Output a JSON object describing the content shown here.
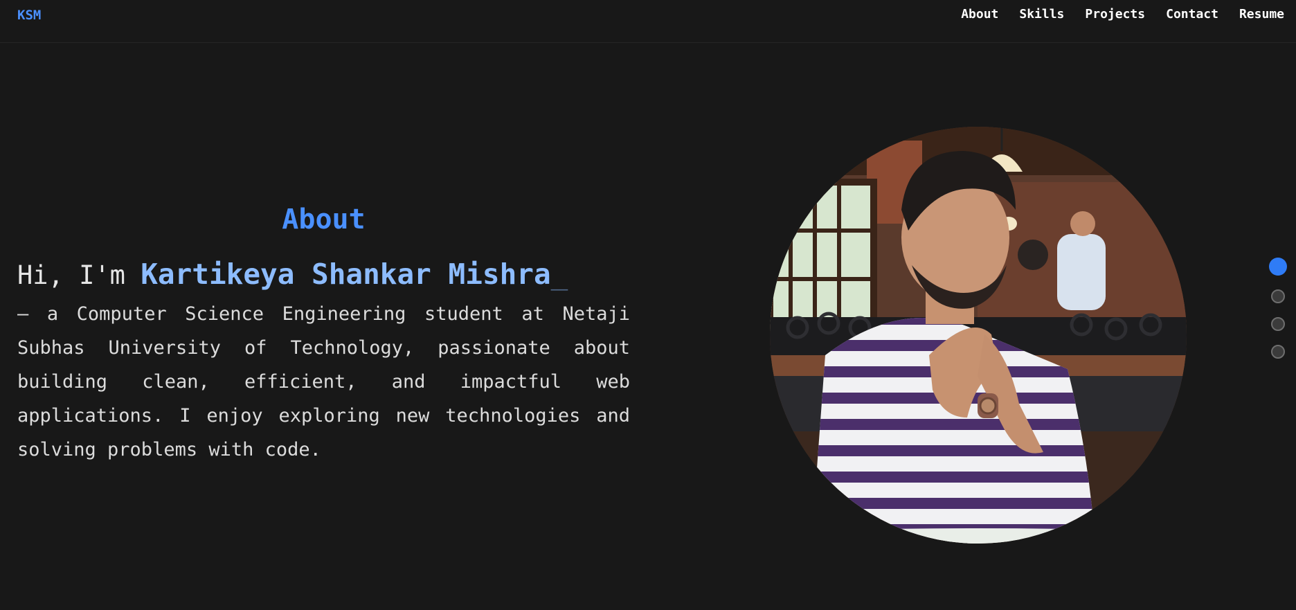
{
  "nav": {
    "logo": "KSM",
    "links": [
      "About",
      "Skills",
      "Projects",
      "Contact",
      "Resume"
    ]
  },
  "about": {
    "title": "About",
    "greeting": "Hi, I'm ",
    "name": "Kartikeya Shankar Mishra",
    "cursor": "_",
    "bio": "— a Computer Science Engineering student at Netaji Subhas University of Technology, passionate about building clean, efficient, and impactful web applications. I enjoy exploring new technologies and solving problems with code.",
    "photo_alt": "Photo of Kartikeya Shankar Mishra"
  },
  "section_nav": {
    "count": 4,
    "active_index": 0
  },
  "colors": {
    "background": "#181818",
    "accent": "#4a90ff",
    "name": "#8dbcff",
    "text": "#dcdcdc"
  }
}
